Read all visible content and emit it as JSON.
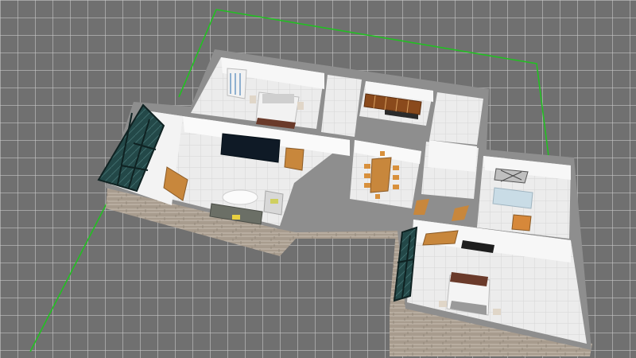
{
  "app": {
    "view": "3d-floor-plan",
    "colors": {
      "ground": "#707070",
      "grid_line": "#c8c8c8",
      "boundary": "#22c022",
      "wall_top": "#8c8c8c",
      "wall_inner": "#f4f4f4",
      "floor_tile": "#ebebeb",
      "exterior_stone": "#a59a8c",
      "window_frame": "#1c3a3a",
      "wood": "#c8873c",
      "tv": "#0f1a26"
    },
    "objects": [
      {
        "name": "window-icon",
        "room": "living"
      },
      {
        "name": "wardrobe-icon",
        "room": "bedroom-1"
      },
      {
        "name": "bed-icon",
        "room": "bedroom-1"
      },
      {
        "name": "kitchen-cabinet-icon",
        "room": "kitchen"
      },
      {
        "name": "tv-icon",
        "room": "living"
      },
      {
        "name": "door-icon",
        "room": "living"
      },
      {
        "name": "dining-table-icon",
        "room": "dining"
      },
      {
        "name": "sofa-icon",
        "room": "living"
      },
      {
        "name": "round-table-icon",
        "room": "living"
      },
      {
        "name": "bathtub-icon",
        "room": "bathroom"
      },
      {
        "name": "bed-icon",
        "room": "bedroom-2"
      },
      {
        "name": "window-icon",
        "room": "bedroom-2"
      }
    ]
  }
}
